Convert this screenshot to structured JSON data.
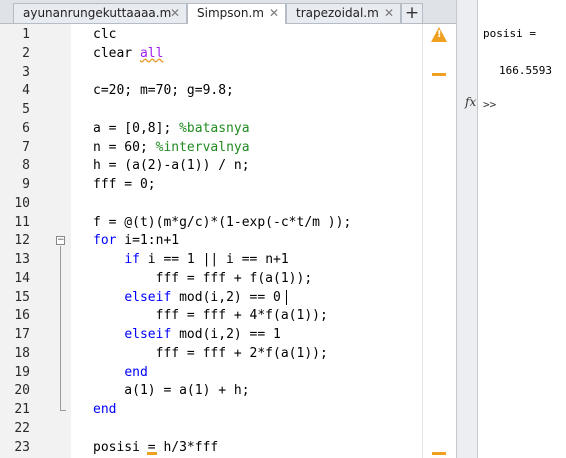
{
  "tabs": [
    {
      "label": "ayunanrungekuttaaaa.m",
      "active": false
    },
    {
      "label": "Simpson.m",
      "active": true
    },
    {
      "label": "trapezoidal.m",
      "active": false
    }
  ],
  "tab_close_glyph": "✕",
  "new_tab_glyph": "+",
  "editor": {
    "lines": [
      {
        "n": "1",
        "segments": [
          {
            "t": "clc",
            "c": ""
          }
        ]
      },
      {
        "n": "2",
        "segments": [
          {
            "t": "clear ",
            "c": ""
          },
          {
            "t": "all",
            "c": "str"
          }
        ]
      },
      {
        "n": "3",
        "segments": []
      },
      {
        "n": "4",
        "segments": [
          {
            "t": "c=20; m=70; g=9.8;",
            "c": ""
          }
        ]
      },
      {
        "n": "5",
        "segments": []
      },
      {
        "n": "6",
        "segments": [
          {
            "t": "a = [0,8]; ",
            "c": ""
          },
          {
            "t": "%batasnya",
            "c": "cm"
          }
        ]
      },
      {
        "n": "7",
        "segments": [
          {
            "t": "n = 60; ",
            "c": ""
          },
          {
            "t": "%intervalnya",
            "c": "cm"
          }
        ]
      },
      {
        "n": "8",
        "segments": [
          {
            "t": "h = (a(2)-a(1)) / n;",
            "c": ""
          }
        ]
      },
      {
        "n": "9",
        "segments": [
          {
            "t": "fff = 0;",
            "c": ""
          }
        ]
      },
      {
        "n": "10",
        "segments": []
      },
      {
        "n": "11",
        "segments": [
          {
            "t": "f = @(t)(m*g/c)*(1-exp(-c*t/m ));",
            "c": ""
          }
        ]
      },
      {
        "n": "12",
        "segments": [
          {
            "t": "for",
            "c": "kw"
          },
          {
            "t": " i=1:n+1",
            "c": ""
          }
        ]
      },
      {
        "n": "13",
        "segments": [
          {
            "t": "    ",
            "c": ""
          },
          {
            "t": "if",
            "c": "kw"
          },
          {
            "t": " i == 1 || i == n+1",
            "c": ""
          }
        ]
      },
      {
        "n": "14",
        "segments": [
          {
            "t": "        fff = fff + f(a(1));",
            "c": ""
          }
        ]
      },
      {
        "n": "15",
        "segments": [
          {
            "t": "    ",
            "c": ""
          },
          {
            "t": "elseif",
            "c": "kw"
          },
          {
            "t": " mod(i,2) == 0",
            "c": ""
          }
        ]
      },
      {
        "n": "16",
        "segments": [
          {
            "t": "        fff = fff + 4*f(a(1));",
            "c": ""
          }
        ]
      },
      {
        "n": "17",
        "segments": [
          {
            "t": "    ",
            "c": ""
          },
          {
            "t": "elseif",
            "c": "kw"
          },
          {
            "t": " mod(i,2) == 1",
            "c": ""
          }
        ]
      },
      {
        "n": "18",
        "segments": [
          {
            "t": "        fff = fff + 2*f(a(1));",
            "c": ""
          }
        ]
      },
      {
        "n": "19",
        "segments": [
          {
            "t": "    ",
            "c": ""
          },
          {
            "t": "end",
            "c": "kw"
          }
        ]
      },
      {
        "n": "20",
        "segments": [
          {
            "t": "    a(1) = a(1) + h;",
            "c": ""
          }
        ]
      },
      {
        "n": "21",
        "segments": [
          {
            "t": "end",
            "c": "kw"
          }
        ]
      },
      {
        "n": "22",
        "segments": []
      },
      {
        "n": "23",
        "segments": [
          {
            "t": "posisi = h/3*fff",
            "c": ""
          }
        ]
      }
    ],
    "warning_glyph": "!",
    "fold_glyph": "−"
  },
  "command_window": {
    "output_var": "posisi =",
    "output_value": "166.5593",
    "fx_label": "fx",
    "prompt": ">>"
  },
  "colors": {
    "keyword": "#0000ff",
    "string": "#a020f0",
    "comment": "#228b22",
    "warning": "#f0a020"
  }
}
